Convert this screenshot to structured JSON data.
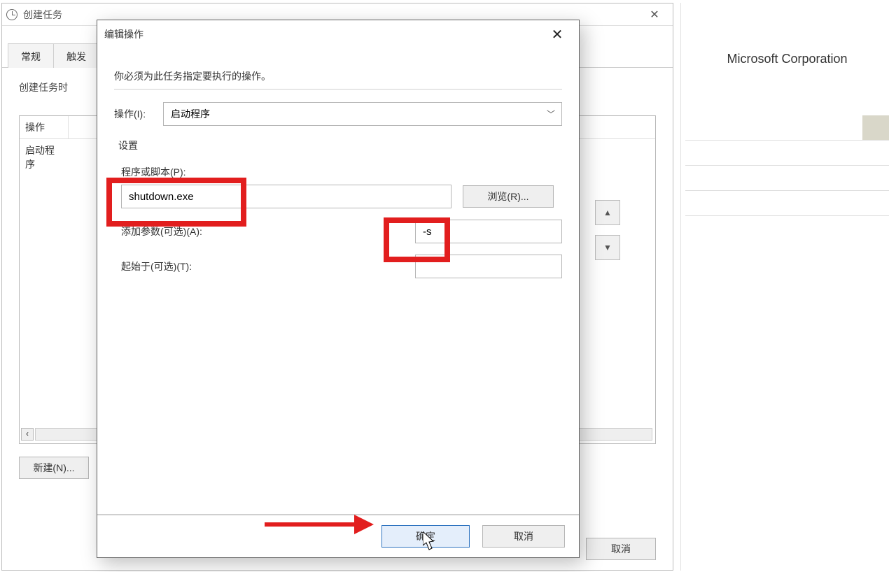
{
  "right": {
    "brand": "Microsoft Corporation"
  },
  "parent": {
    "title": "创建任务",
    "tabs": {
      "general": "常规",
      "trigger": "触发"
    },
    "desc": "创建任务时",
    "table": {
      "col_action": "操作",
      "row_action": "启动程序"
    },
    "new_button": "新建(N)...",
    "cancel": "取消",
    "arrow_up": "▲",
    "arrow_down": "▼",
    "scroll_left_glyph": "‹"
  },
  "modal": {
    "title": "编辑操作",
    "desc": "你必须为此任务指定要执行的操作。",
    "action_label": "操作(I):",
    "action_value": "启动程序",
    "group_settings": "设置",
    "program_label": "程序或脚本(P):",
    "program_value": "shutdown.exe",
    "browse": "浏览(R)...",
    "args_label": "添加参数(可选)(A):",
    "args_value": "-s",
    "startin_label": "起始于(可选)(T):",
    "startin_value": "",
    "ok": "确定",
    "cancel": "取消"
  },
  "glyphs": {
    "close": "✕",
    "chevron": "﹀"
  }
}
